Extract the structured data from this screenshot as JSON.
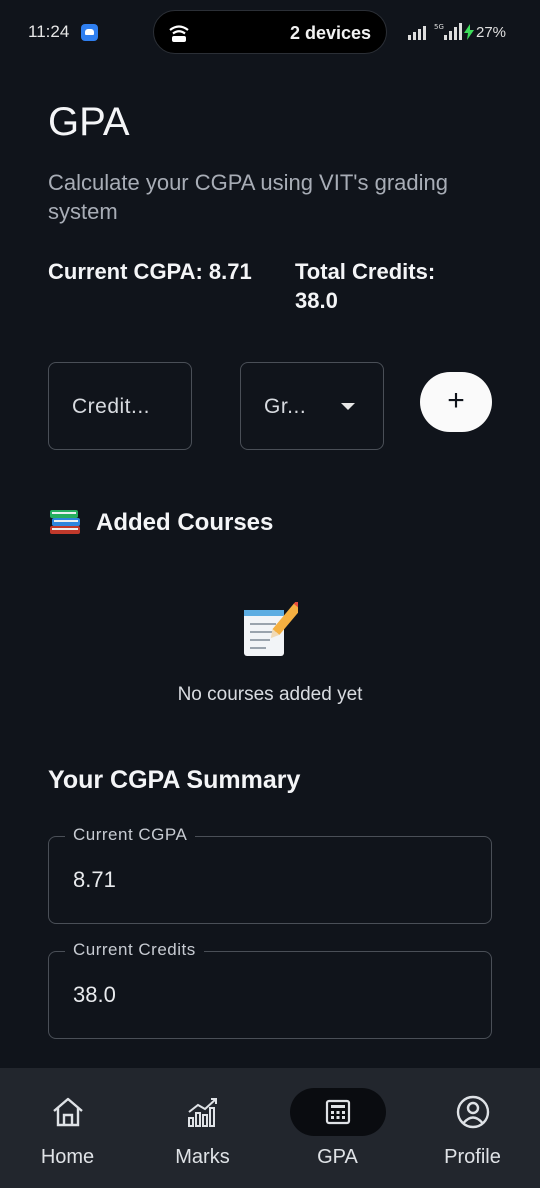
{
  "status_bar": {
    "time": "11:24",
    "pill_text": "2 devices",
    "battery": "27%"
  },
  "page": {
    "title": "GPA",
    "subtitle": "Calculate your CGPA using VIT's grading system",
    "current_cgpa_stat": "Current CGPA: 8.71",
    "total_credits_stat": "Total Credits: 38.0"
  },
  "form": {
    "credits_placeholder": "Credit...",
    "grade_placeholder": "Gr...",
    "add_label": "+"
  },
  "courses": {
    "heading": "Added Courses",
    "empty_text": "No courses added yet"
  },
  "summary": {
    "heading": "Your CGPA Summary",
    "fields": [
      {
        "label": "Current CGPA",
        "value": "8.71"
      },
      {
        "label": "Current Credits",
        "value": "38.0"
      }
    ]
  },
  "nav": {
    "items": [
      {
        "label": "Home",
        "icon": "home-icon"
      },
      {
        "label": "Marks",
        "icon": "chart-icon"
      },
      {
        "label": "GPA",
        "icon": "calculator-icon",
        "active": true
      },
      {
        "label": "Profile",
        "icon": "profile-icon"
      }
    ]
  },
  "colors": {
    "background": "#10141b",
    "nav_background": "#22262d",
    "active_pill": "#0a0c10",
    "accent_button": "#fafafa"
  }
}
